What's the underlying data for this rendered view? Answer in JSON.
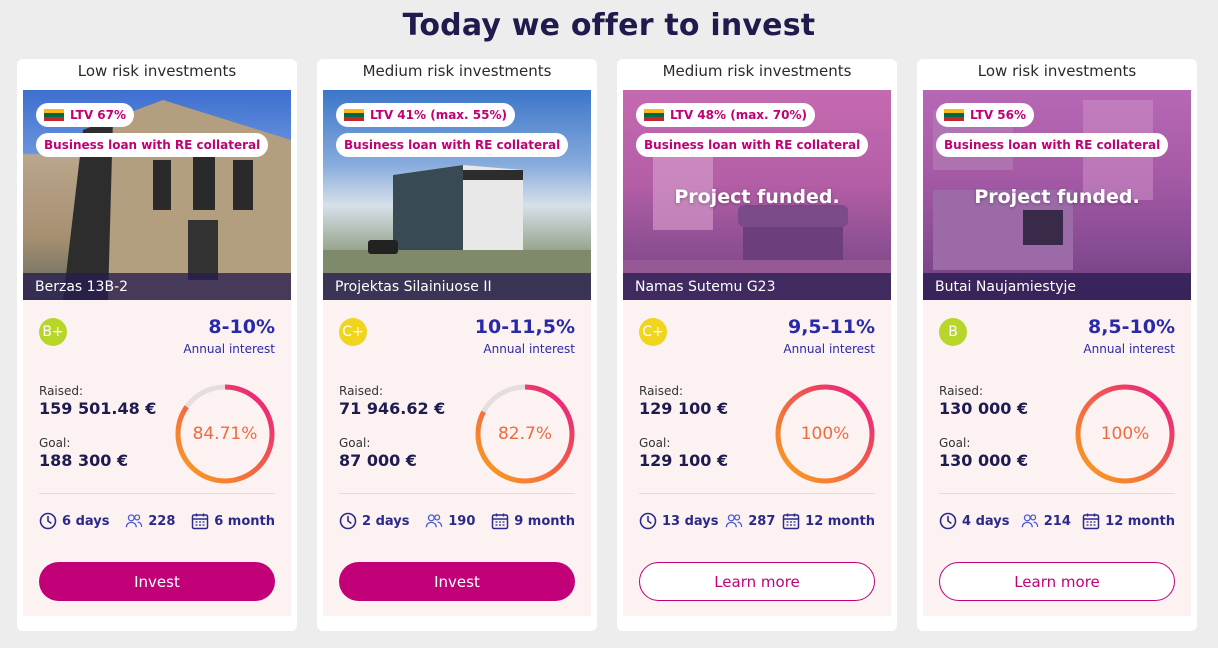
{
  "page": {
    "title": "Today we offer to invest"
  },
  "colors": {
    "accent": "#c20178",
    "navy": "#2a2aa8",
    "grade_green": "#b8d62a",
    "grade_yellow": "#f0d41d"
  },
  "cards": [
    {
      "risk": "Low risk investments",
      "ltv": "LTV 67%",
      "loan_type": "Business loan with RE collateral",
      "funded_text": "",
      "name": "Berzas 13B-2",
      "grade": "B+",
      "grade_color": "#b8d62a",
      "rate": "8-10%",
      "rate_label": "Annual interest",
      "raised_label": "Raised:",
      "raised": "159 501.48 €",
      "goal_label": "Goal:",
      "goal": "188 300 €",
      "progress_text": "84.71%",
      "progress": 0.8471,
      "days": "6 days",
      "investors": "228",
      "term": "6 month",
      "button": "Invest",
      "button_style": "primary"
    },
    {
      "risk": "Medium risk investments",
      "ltv": "LTV 41% (max. 55%)",
      "loan_type": "Business loan with RE collateral",
      "funded_text": "",
      "name": "Projektas Silainiuose II",
      "grade": "C+",
      "grade_color": "#f0d41d",
      "rate": "10-11,5%",
      "rate_label": "Annual interest",
      "raised_label": "Raised:",
      "raised": "71 946.62 €",
      "goal_label": "Goal:",
      "goal": "87 000 €",
      "progress_text": "82.7%",
      "progress": 0.827,
      "days": "2 days",
      "investors": "190",
      "term": "9 month",
      "button": "Invest",
      "button_style": "primary"
    },
    {
      "risk": "Medium risk investments",
      "ltv": "LTV 48% (max. 70%)",
      "loan_type": "Business loan with RE collateral",
      "funded_text": "Project funded.",
      "name": "Namas Sutemu G23",
      "grade": "C+",
      "grade_color": "#f0d41d",
      "rate": "9,5-11%",
      "rate_label": "Annual interest",
      "raised_label": "Raised:",
      "raised": "129 100 €",
      "goal_label": "Goal:",
      "goal": "129 100 €",
      "progress_text": "100%",
      "progress": 1.0,
      "days": "13 days",
      "investors": "287",
      "term": "12 month",
      "button": "Learn more",
      "button_style": "outline"
    },
    {
      "risk": "Low risk investments",
      "ltv": "LTV 56%",
      "loan_type": "Business loan with RE collateral",
      "funded_text": "Project funded.",
      "name": "Butai Naujamiestyje",
      "grade": "B",
      "grade_color": "#b8d62a",
      "rate": "8,5-10%",
      "rate_label": "Annual interest",
      "raised_label": "Raised:",
      "raised": "130 000 €",
      "goal_label": "Goal:",
      "goal": "130 000 €",
      "progress_text": "100%",
      "progress": 1.0,
      "days": "4 days",
      "investors": "214",
      "term": "12 month",
      "button": "Learn more",
      "button_style": "outline"
    }
  ]
}
